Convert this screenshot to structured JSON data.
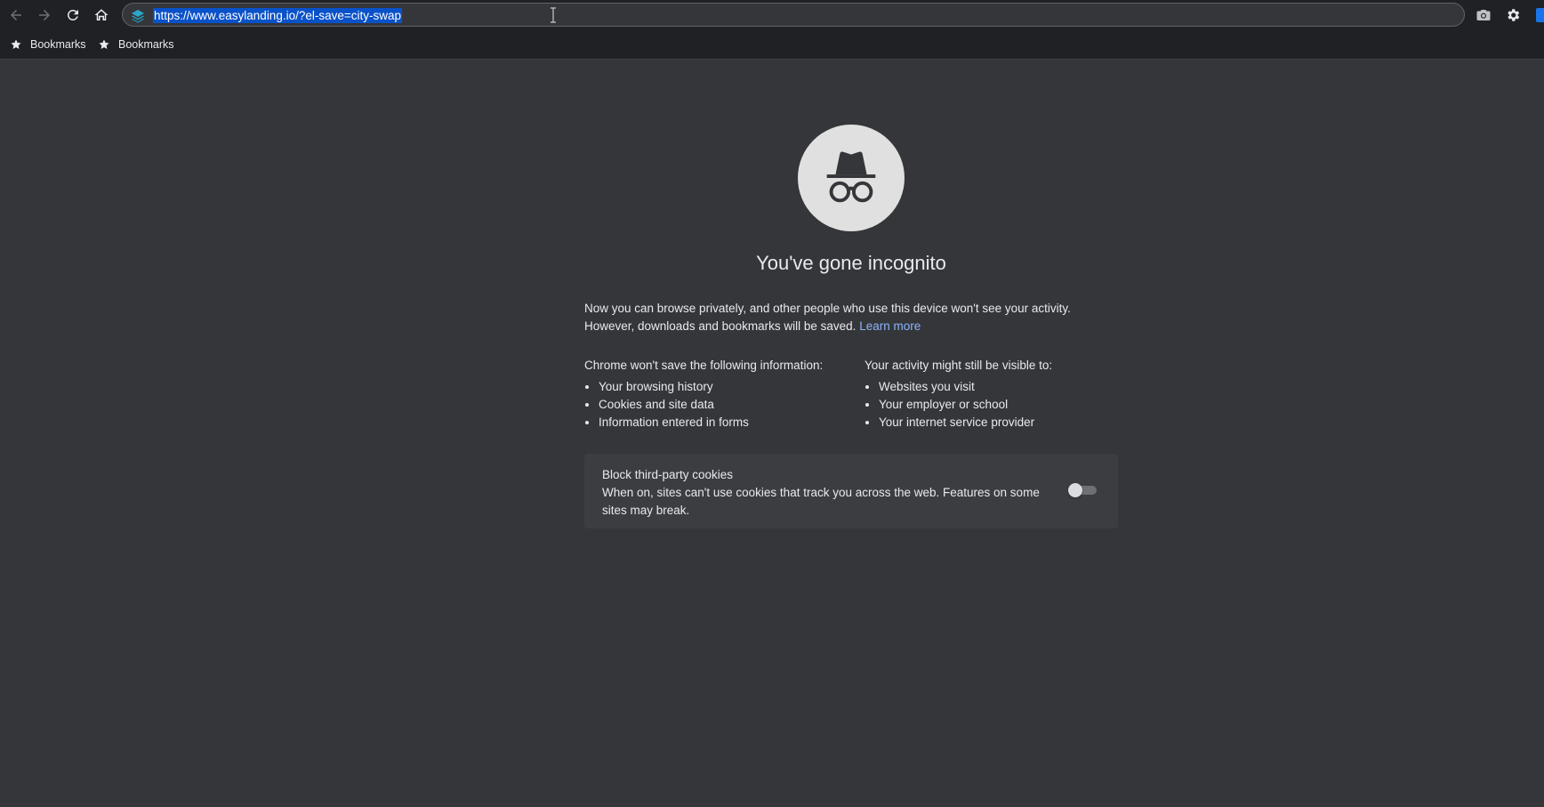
{
  "omnibox": {
    "url": "https://www.easylanding.io/?el-save=city-swap"
  },
  "bookmarks_bar": {
    "items": [
      {
        "label": "Bookmarks"
      },
      {
        "label": "Bookmarks"
      }
    ]
  },
  "ntp": {
    "title": "You've gone incognito",
    "intro_text": "Now you can browse privately, and other people who use this device won't see your activity. However, downloads and bookmarks will be saved.",
    "learn_more": "Learn more",
    "wont_save": {
      "heading": "Chrome won't save the following information:",
      "items": [
        "Your browsing history",
        "Cookies and site data",
        "Information entered in forms"
      ]
    },
    "visible_to": {
      "heading": "Your activity might still be visible to:",
      "items": [
        "Websites you visit",
        "Your employer or school",
        "Your internet service provider"
      ]
    },
    "cookie_card": {
      "title": "Block third-party cookies",
      "description": "When on, sites can't use cookies that track you across the web. Features on some sites may break.",
      "toggle_on": false
    }
  },
  "colors": {
    "page_background": "#35363a",
    "toolbar_background": "#202124",
    "link": "#8ab4f8",
    "selection": "#0a52c9"
  }
}
